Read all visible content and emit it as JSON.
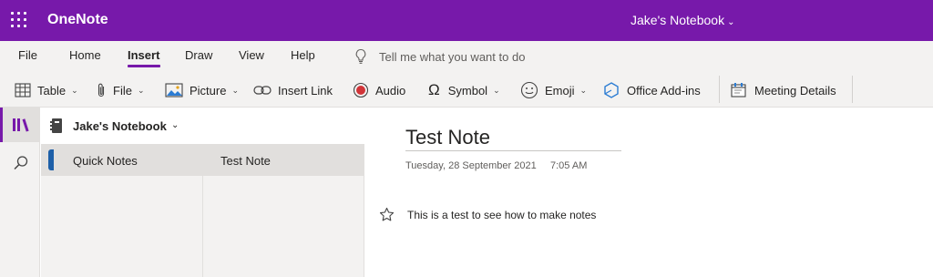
{
  "app": {
    "name": "OneNote",
    "notebook_title": "Jake's Notebook"
  },
  "menu": {
    "tabs": [
      "File",
      "Home",
      "Insert",
      "Draw",
      "View",
      "Help"
    ],
    "active_tab": "Insert",
    "tell_me_placeholder": "Tell me what you want to do"
  },
  "ribbon": {
    "table": "Table",
    "file": "File",
    "picture": "Picture",
    "insert_link": "Insert Link",
    "audio": "Audio",
    "symbol": "Symbol",
    "emoji": "Emoji",
    "office_addins": "Office Add-ins",
    "meeting_details": "Meeting Details"
  },
  "navigation": {
    "notebook_name": "Jake's Notebook",
    "sections": [
      {
        "label": "Quick Notes",
        "color": "#1d5fa8"
      }
    ],
    "pages": [
      {
        "label": "Test Note"
      }
    ]
  },
  "page": {
    "title": "Test Note",
    "date": "Tuesday, 28 September 2021",
    "time": "7:05 AM",
    "body": "This is a test to see how to make notes"
  },
  "colors": {
    "accent": "#7719aa",
    "section_blue": "#1d5fa8"
  },
  "icons": [
    "app-launcher-icon",
    "lightbulb-icon",
    "table-icon",
    "paperclip-icon",
    "picture-icon",
    "link-icon",
    "record-icon",
    "omega-icon",
    "emoji-icon",
    "office-addins-icon",
    "meeting-details-icon",
    "notebooks-icon",
    "search-icon",
    "notebook-icon",
    "star-icon"
  ]
}
